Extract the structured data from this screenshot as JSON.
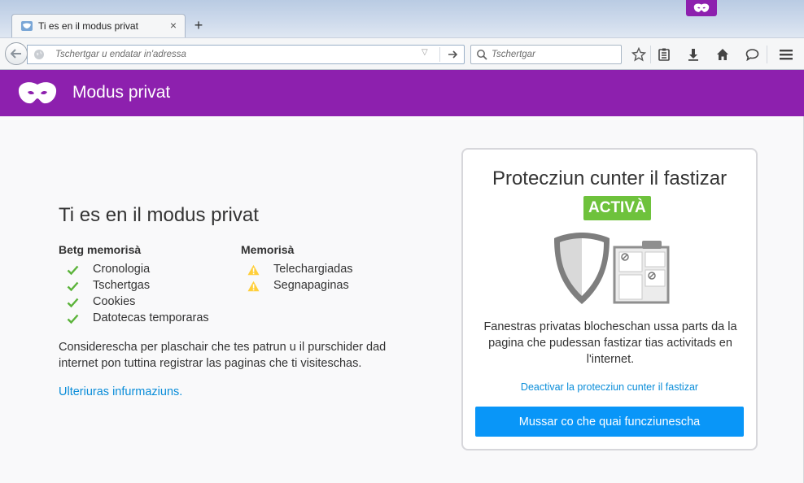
{
  "tab": {
    "title": "Ti es en il modus privat",
    "new_tab_label": "+"
  },
  "toolbar": {
    "url_placeholder": "Tschertgar u endatar in'adressa",
    "search_placeholder": "Tschertgar"
  },
  "header": {
    "title": "Modus privat"
  },
  "main": {
    "title": "Ti es en il modus privat",
    "not_saved_heading": "Betg memorisà",
    "not_saved_items": [
      "Cronologia",
      "Tschertgas",
      "Cookies",
      "Datotecas temporaras"
    ],
    "saved_heading": "Memorisà",
    "saved_items": [
      "Telechargiadas",
      "Segnapaginas"
    ],
    "description": "Considerescha per plaschair che tes patrun u il purschider dad internet pon tuttina registrar las paginas che ti visiteschas.",
    "learn_more": "Ulteriuras infurmaziuns."
  },
  "tracking_card": {
    "title": "Protecziun cunter il fastizar",
    "status": "ACTIVÀ",
    "description": "Fanestras privatas blocheschan ussa parts da la pagina che pudessan fastizar tias activitads en l'internet.",
    "toggle_link": "Deactivar la protecziun cunter il fastizar",
    "button_label": "Mussar co che quai funcziunescha"
  },
  "colors": {
    "private_purple": "#8d20ae",
    "badge_green": "#6ec23c",
    "link_blue": "#0a8dd9",
    "button_blue": "#0996f8",
    "check_green": "#5bb33a",
    "warning_yellow": "#ffcf3a"
  },
  "icons": {
    "tab": "private-tab-favicon",
    "header": "private-mask-icon",
    "toolbar": [
      "back-arrow-icon",
      "globe-icon",
      "dropdown-arrow-icon",
      "go-arrow-icon",
      "search-icon",
      "star-icon",
      "reading-list-icon",
      "download-icon",
      "home-icon",
      "chat-icon",
      "hamburger-menu-icon"
    ]
  }
}
